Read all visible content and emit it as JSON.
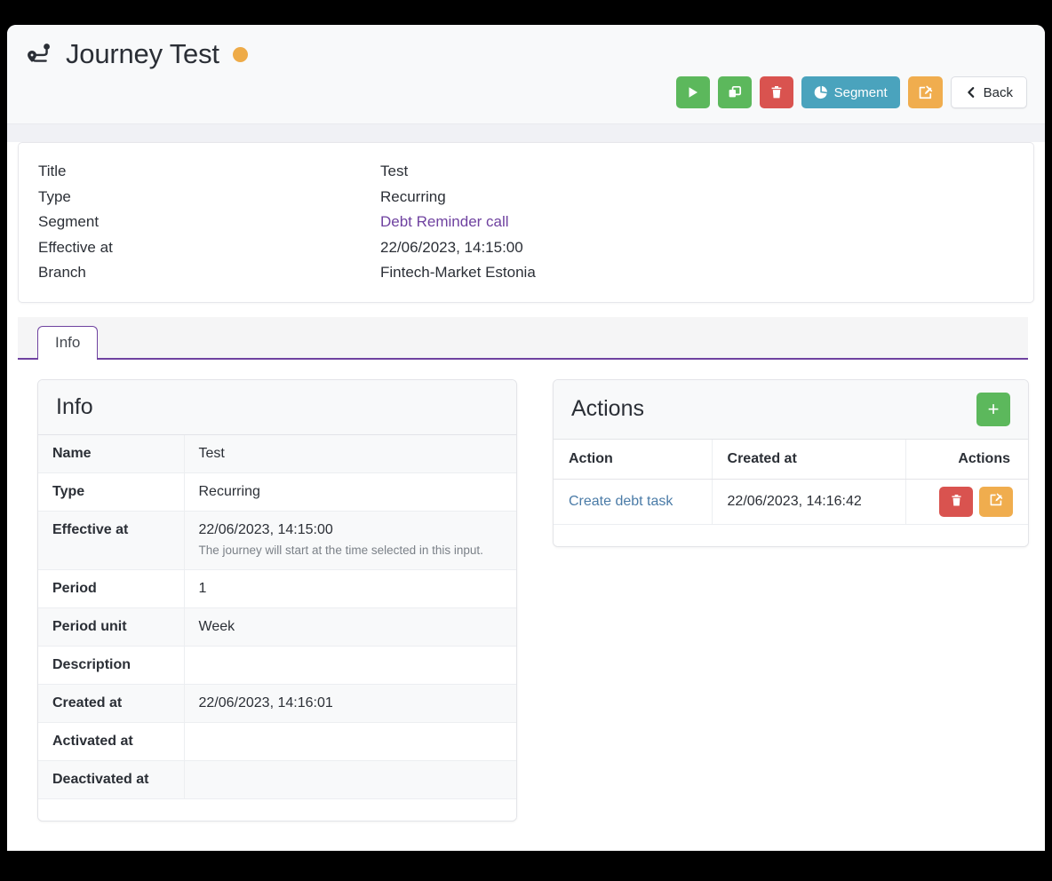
{
  "header": {
    "title": "Journey Test",
    "journey_icon": "route-icon",
    "status_dot_color": "#eeab48",
    "toolbar": {
      "run_label": "",
      "run_icon": "play-icon",
      "duplicate_label": "",
      "duplicate_icon": "copy-icon",
      "delete_label": "",
      "delete_icon": "trash-icon",
      "segment_label": "Segment",
      "segment_icon": "pie-chart-icon",
      "edit_label": "",
      "edit_icon": "edit-pencil-icon",
      "back_label": "Back",
      "back_icon": "chevron-left-icon"
    }
  },
  "summary": {
    "rows": [
      {
        "label": "Title",
        "value": "Test",
        "link": false
      },
      {
        "label": "Type",
        "value": "Recurring",
        "link": false
      },
      {
        "label": "Segment",
        "value": "Debt Reminder call",
        "link": true
      },
      {
        "label": "Effective at",
        "value": "22/06/2023, 14:15:00",
        "link": false
      },
      {
        "label": "Branch",
        "value": "Fintech-Market Estonia",
        "link": false
      }
    ]
  },
  "tabs": [
    {
      "label": "Info",
      "active": true
    }
  ],
  "info_card": {
    "title": "Info",
    "rows": [
      {
        "key": "Name",
        "value": "Test",
        "hint": ""
      },
      {
        "key": "Type",
        "value": "Recurring",
        "hint": ""
      },
      {
        "key": "Effective at",
        "value": "22/06/2023, 14:15:00",
        "hint": "The journey will start at the time selected in this input."
      },
      {
        "key": "Period",
        "value": "1",
        "hint": ""
      },
      {
        "key": "Period unit",
        "value": "Week",
        "hint": ""
      },
      {
        "key": "Description",
        "value": "",
        "hint": ""
      },
      {
        "key": "Created at",
        "value": "22/06/2023, 14:16:01",
        "hint": ""
      },
      {
        "key": "Activated at",
        "value": "",
        "hint": ""
      },
      {
        "key": "Deactivated at",
        "value": "",
        "hint": ""
      }
    ]
  },
  "actions_card": {
    "title": "Actions",
    "add_label": "+",
    "columns": [
      "Action",
      "Created at",
      "Actions"
    ],
    "rows": [
      {
        "action": "Create debt task",
        "created_at": "22/06/2023, 14:16:42",
        "delete_icon": "trash-icon",
        "edit_icon": "edit-pencil-icon"
      }
    ]
  },
  "colors": {
    "accent_purple": "#6f42a0",
    "link_blue": "#4a7ba7",
    "green": "#5cb85c",
    "red": "#d9534f",
    "orange": "#f0ad4e",
    "teal": "#4aa3bd"
  }
}
